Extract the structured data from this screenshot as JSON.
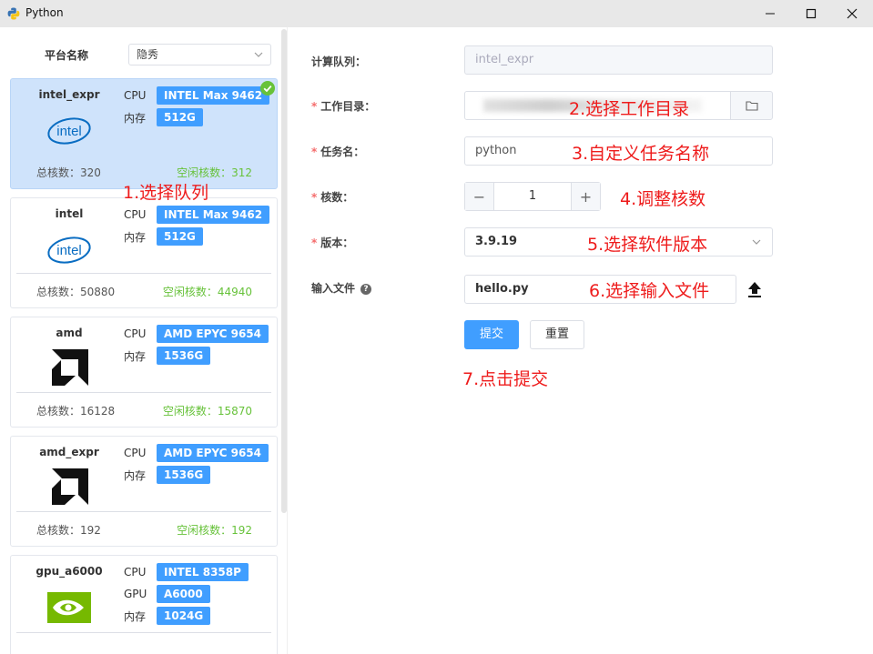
{
  "window": {
    "title": "Python"
  },
  "left": {
    "platform_label": "平台名称",
    "platform_value": "隐秀",
    "cards": [
      {
        "name": "intel_expr",
        "logo": "intel-logo-icon",
        "specs": [
          {
            "k": "CPU",
            "v": "INTEL Max 9462"
          },
          {
            "k": "内存",
            "v": "512G"
          }
        ],
        "total": "总核数：320",
        "free": "空闲核数：312",
        "selected": true
      },
      {
        "name": "intel",
        "logo": "intel-logo-icon",
        "specs": [
          {
            "k": "CPU",
            "v": "INTEL Max 9462"
          },
          {
            "k": "内存",
            "v": "512G"
          }
        ],
        "total": "总核数：50880",
        "free": "空闲核数：44940"
      },
      {
        "name": "amd",
        "logo": "amd-logo-icon",
        "specs": [
          {
            "k": "CPU",
            "v": "AMD EPYC 9654"
          },
          {
            "k": "内存",
            "v": "1536G"
          }
        ],
        "total": "总核数：16128",
        "free": "空闲核数：15870"
      },
      {
        "name": "amd_expr",
        "logo": "amd-logo-icon",
        "specs": [
          {
            "k": "CPU",
            "v": "AMD EPYC 9654"
          },
          {
            "k": "内存",
            "v": "1536G"
          }
        ],
        "total": "总核数：192",
        "free": "空闲核数：192"
      },
      {
        "name": "gpu_a6000",
        "logo": "nvidia-logo-icon",
        "specs": [
          {
            "k": "CPU",
            "v": "INTEL 8358P"
          },
          {
            "k": "GPU",
            "v": "A6000"
          },
          {
            "k": "内存",
            "v": "1024G"
          }
        ]
      }
    ]
  },
  "form": {
    "queue_label": "计算队列：",
    "queue_value": "intel_expr",
    "workdir_label": "工作目录：",
    "jobname_label": "任务名：",
    "jobname_value": "python",
    "cores_label": "核数：",
    "cores_value": "1",
    "version_label": "版本：",
    "version_value": "3.9.19",
    "input_label": "输入文件",
    "input_value": "hello.py",
    "submit_label": "提交",
    "reset_label": "重置",
    "required_mark": "*",
    "help_mark": "?",
    "minus": "−",
    "plus": "+"
  },
  "annotations": {
    "a1": "1.选择队列",
    "a2": "2.选择工作目录",
    "a3": "3.自定义任务名称",
    "a4": "4.调整核数",
    "a5": "5.选择软件版本",
    "a6": "6.选择输入文件",
    "a7": "7.点击提交"
  },
  "colors": {
    "primary": "#409eff",
    "free": "#67c23a",
    "annotation": "#ee1c1c",
    "selected_bg": "#cfe3fb"
  }
}
